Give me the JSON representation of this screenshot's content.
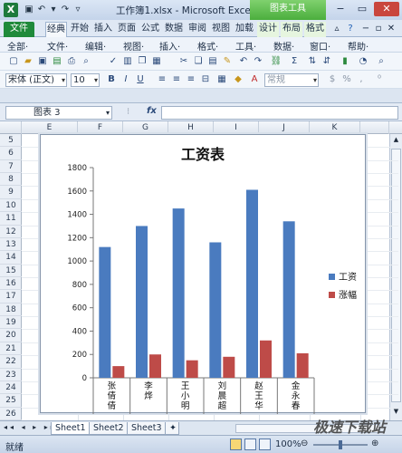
{
  "window": {
    "title": "工作簿1.xlsx - Microsoft Excel",
    "context_title": "图表工具",
    "app_icon": "excel-icon",
    "controls": [
      "minimize-icon",
      "maximize-icon",
      "close-icon"
    ]
  },
  "tabs": [
    {
      "label": "文件"
    },
    {
      "label": "经典"
    },
    {
      "label": "开始"
    },
    {
      "label": "插入"
    },
    {
      "label": "页面"
    },
    {
      "label": "公式"
    },
    {
      "label": "数据"
    },
    {
      "label": "审阅"
    },
    {
      "label": "视图"
    },
    {
      "label": "加载"
    },
    {
      "label": "设计"
    },
    {
      "label": "布局"
    },
    {
      "label": "格式"
    }
  ],
  "menus": [
    {
      "label": "全部·"
    },
    {
      "label": "文件·"
    },
    {
      "label": "编辑·"
    },
    {
      "label": "视图·"
    },
    {
      "label": "插入·"
    },
    {
      "label": "格式·"
    },
    {
      "label": "工具·"
    },
    {
      "label": "数据·"
    },
    {
      "label": "窗口·"
    },
    {
      "label": "帮助·"
    }
  ],
  "toolbar": {
    "font": "宋体 (正文)",
    "size": "10",
    "bold": "B",
    "italic": "I",
    "underline": "U",
    "number_format": "常规"
  },
  "formula_bar": {
    "name_box": "图表 3",
    "fx": "fx"
  },
  "columns": [
    "E",
    "F",
    "G",
    "H",
    "I",
    "J",
    "K"
  ],
  "rows": [
    "5",
    "6",
    "7",
    "8",
    "9",
    "10",
    "11",
    "12",
    "13",
    "14",
    "15",
    "16",
    "17",
    "18",
    "19",
    "20",
    "21",
    "22",
    "23",
    "24",
    "25",
    "26"
  ],
  "chart_data": {
    "type": "bar",
    "title": "工资表",
    "categories": [
      "张倩倩",
      "李烨",
      "王小明",
      "刘晨超",
      "赵王华",
      "金永春"
    ],
    "series": [
      {
        "name": "工资",
        "values": [
          1120,
          1300,
          1450,
          1160,
          1610,
          1340
        ],
        "color": "#4a7bbf"
      },
      {
        "name": "涨幅",
        "values": [
          100,
          200,
          150,
          180,
          320,
          210
        ],
        "color": "#be4b48"
      }
    ],
    "ylim": [
      0,
      1800
    ],
    "yticks": [
      "0",
      "200",
      "400",
      "600",
      "800",
      "1000",
      "1200",
      "1400",
      "1600",
      "1800"
    ],
    "legend": "right",
    "grid": false
  },
  "sheets": [
    {
      "label": "Sheet1",
      "active": true
    },
    {
      "label": "Sheet2",
      "active": false
    },
    {
      "label": "Sheet3",
      "active": false
    }
  ],
  "status": {
    "ready": "就绪",
    "zoom": "100%"
  },
  "watermark": "极速下载站"
}
